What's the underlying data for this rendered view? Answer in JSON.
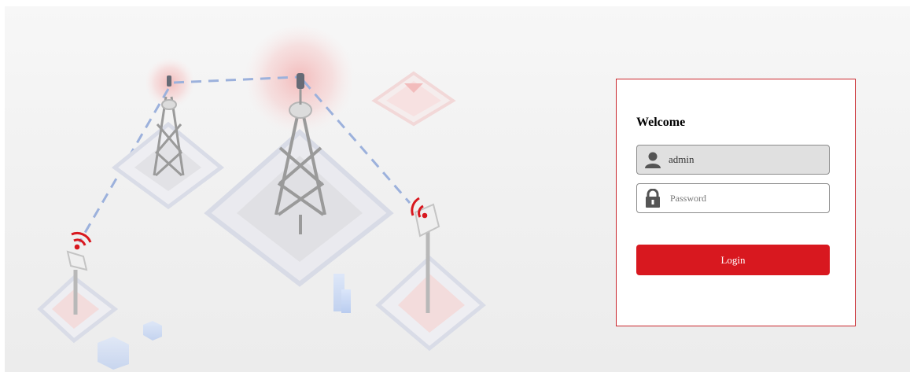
{
  "login": {
    "title": "Welcome",
    "username_value": "admin",
    "password_placeholder": "Password",
    "login_label": "Login"
  },
  "icons": {
    "username": "user-icon",
    "password": "lock-icon"
  },
  "colors": {
    "accent": "#d8181f",
    "panel_border": "#c9262c"
  }
}
